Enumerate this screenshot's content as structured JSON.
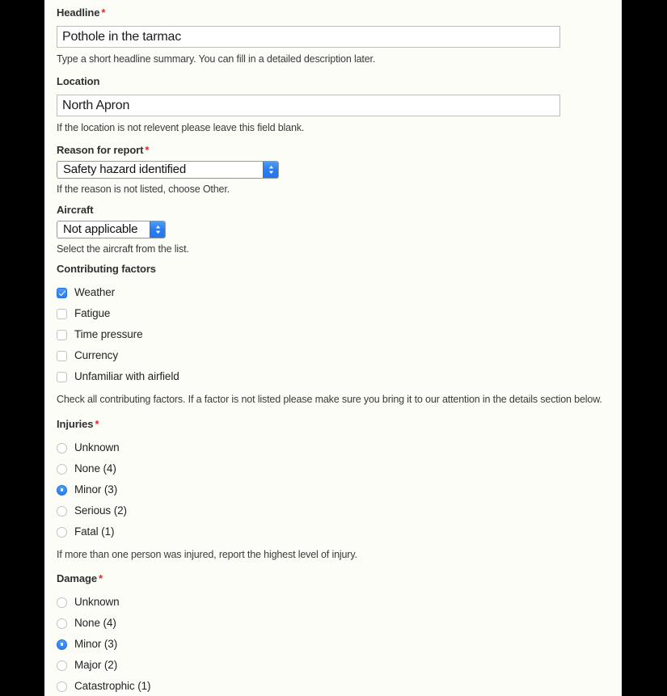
{
  "theme": {
    "page_background": "#fdfdf8",
    "letterbox": "#000000",
    "accent_blue": "#2a7ef0",
    "required_red": "#e8252a",
    "label_color": "#2f2f2f",
    "help_color": "#3a3a3a",
    "input_border": "#bdbdb8"
  },
  "form": {
    "headline": {
      "label": "Headline",
      "required_marker": "*",
      "value": "Pothole in the tarmac",
      "placeholder": "",
      "help": "Type a short headline summary. You can fill in a detailed description later."
    },
    "location": {
      "label": "Location",
      "value": "North Apron",
      "placeholder": "",
      "help": "If the location is not relevent please leave this field blank."
    },
    "reason": {
      "label": "Reason for report",
      "required_marker": "*",
      "selected": "Safety hazard identified",
      "help": "If the reason is not listed, choose Other."
    },
    "aircraft": {
      "label": "Aircraft",
      "selected": "Not applicable",
      "help": "Select the aircraft from the list."
    },
    "contributing_factors": {
      "label": "Contributing factors",
      "help": "Check all contributing factors. If a factor is not listed please make sure you bring it to our attention in the details section below.",
      "options": [
        {
          "label": "Weather",
          "checked": true
        },
        {
          "label": "Fatigue",
          "checked": false
        },
        {
          "label": "Time pressure",
          "checked": false
        },
        {
          "label": "Currency",
          "checked": false
        },
        {
          "label": "Unfamiliar with airfield",
          "checked": false
        }
      ]
    },
    "injuries": {
      "label": "Injuries",
      "required_marker": "*",
      "help": "If more than one person was injured, report the highest level of injury.",
      "options": [
        {
          "label": "Unknown",
          "selected": false
        },
        {
          "label": "None (4)",
          "selected": false
        },
        {
          "label": "Minor (3)",
          "selected": true
        },
        {
          "label": "Serious (2)",
          "selected": false
        },
        {
          "label": "Fatal (1)",
          "selected": false
        }
      ]
    },
    "damage": {
      "label": "Damage",
      "required_marker": "*",
      "options": [
        {
          "label": "Unknown",
          "selected": false
        },
        {
          "label": "None (4)",
          "selected": false
        },
        {
          "label": "Minor (3)",
          "selected": true
        },
        {
          "label": "Major (2)",
          "selected": false
        },
        {
          "label": "Catastrophic (1)",
          "selected": false
        }
      ]
    }
  }
}
